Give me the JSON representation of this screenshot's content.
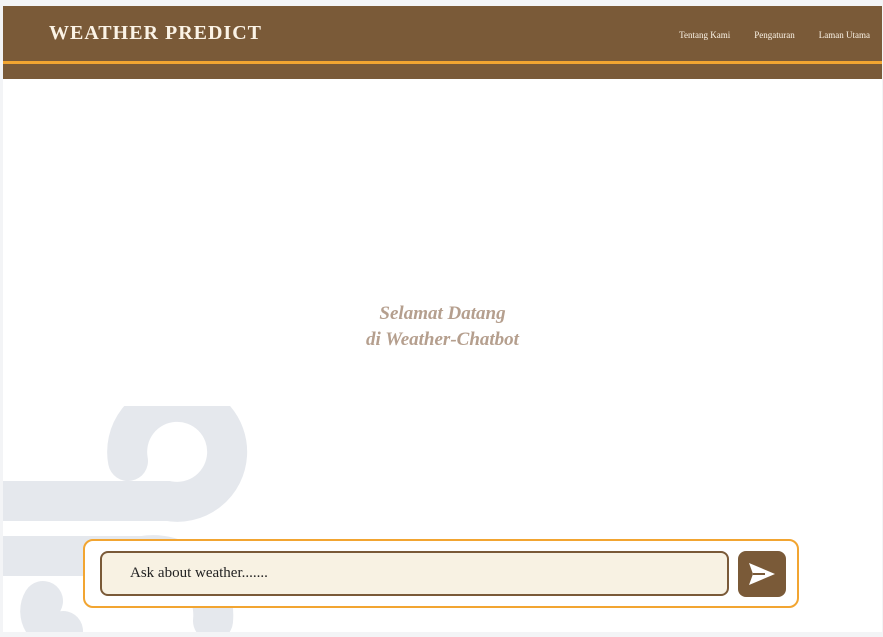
{
  "header": {
    "brand": "WEATHER PREDICT",
    "nav": [
      {
        "label": "Tentang Kami"
      },
      {
        "label": "Pengaturan"
      },
      {
        "label": "Laman Utama"
      }
    ]
  },
  "main": {
    "welcome_line1": "Selamat Datang",
    "welcome_line2": "di Weather-Chatbot"
  },
  "chat": {
    "placeholder": "Ask about weather.......",
    "send_icon": "send-arrow-icon"
  },
  "colors": {
    "brand_brown": "#7a5a38",
    "accent_orange": "#f2a531",
    "input_bg": "#f8f2e3",
    "welcome_text": "#b59f8e"
  }
}
